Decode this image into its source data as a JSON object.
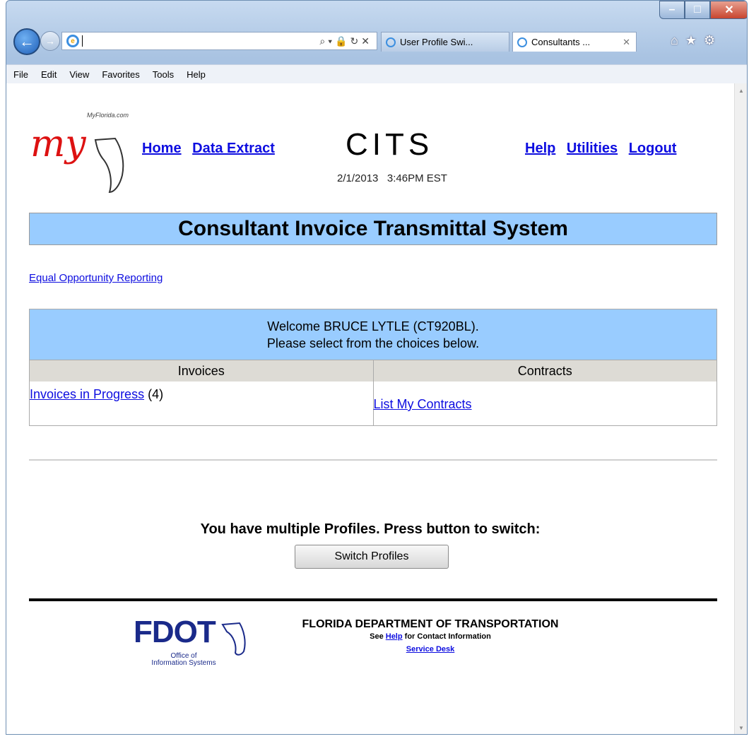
{
  "browser": {
    "address_value": "",
    "tabs": [
      {
        "label": "User Profile Swi..."
      },
      {
        "label": "Consultants ..."
      }
    ],
    "menu": [
      "File",
      "Edit",
      "View",
      "Favorites",
      "Tools",
      "Help"
    ]
  },
  "header": {
    "logo_source": "MyFlorida.com",
    "logo_text": "my",
    "nav_left": [
      "Home",
      "Data Extract"
    ],
    "app_short": "CITS",
    "datetime": "2/1/2013   3:46PM EST",
    "nav_right": [
      "Help",
      "Utilities",
      "Logout"
    ]
  },
  "banner": {
    "title": "Consultant Invoice Transmittal System"
  },
  "links": {
    "equal_opportunity": "Equal Opportunity Reporting"
  },
  "welcome": {
    "line1": "Welcome BRUCE LYTLE (CT920BL).",
    "line2": "Please select from the choices below.",
    "col_invoices": "Invoices",
    "col_contracts": "Contracts",
    "invoices_link": "Invoices in Progress",
    "invoices_count": "(4)",
    "contracts_link": "List My Contracts"
  },
  "profiles": {
    "message": "You have multiple Profiles. Press button to switch:",
    "button": "Switch Profiles"
  },
  "footer": {
    "fdot_logo": "FDOT",
    "fdot_sub1": "Office of",
    "fdot_sub2": "Information Systems",
    "department": "FLORIDA DEPARTMENT OF TRANSPORTATION",
    "see": "See",
    "help_link": "Help",
    "contact": "for Contact Information",
    "service_desk": "Service Desk"
  }
}
